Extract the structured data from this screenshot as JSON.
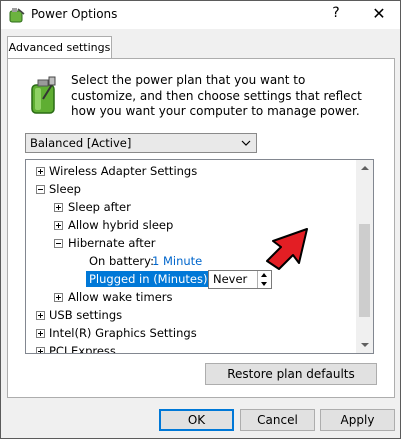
{
  "window": {
    "title": "Power Options",
    "help_glyph": "?",
    "close_glyph": "✕"
  },
  "tabs": [
    {
      "label": "Advanced settings"
    }
  ],
  "panel": {
    "description": "Select the power plan that you want to customize, and then choose settings that reflect how you want your computer to manage power.",
    "plan_select": {
      "value": "Balanced [Active]"
    }
  },
  "tree": {
    "items": [
      {
        "label": "Wireless Adapter Settings",
        "state": "collapsed"
      },
      {
        "label": "Sleep",
        "state": "expanded"
      },
      {
        "label": "Sleep after",
        "state": "collapsed"
      },
      {
        "label": "Allow hybrid sleep",
        "state": "collapsed"
      },
      {
        "label": "Hibernate after",
        "state": "expanded"
      },
      {
        "label": "On battery:",
        "value": "1 Minute"
      },
      {
        "label": "Plugged in (Minutes):",
        "value": "Never",
        "selected": true
      },
      {
        "label": "Allow wake timers",
        "state": "collapsed"
      },
      {
        "label": "USB settings",
        "state": "collapsed"
      },
      {
        "label": "Intel(R) Graphics Settings",
        "state": "collapsed"
      },
      {
        "label": "PCI Express",
        "state": "collapsed"
      }
    ]
  },
  "buttons": {
    "restore": "Restore plan defaults",
    "ok": "OK",
    "cancel": "Cancel",
    "apply": "Apply"
  },
  "colors": {
    "selection": "#0078d7",
    "link": "#0066cc",
    "annotation_arrow": "#e31e24"
  }
}
